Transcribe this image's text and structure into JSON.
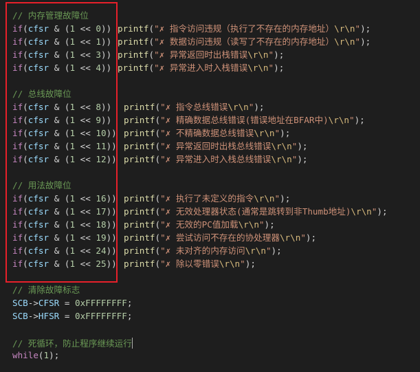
{
  "editor": {
    "accent": "#e8202a",
    "lines": [
      {
        "type": "comment",
        "text": "// 内存管理故障位"
      },
      {
        "type": "if",
        "reg": "cfsr",
        "bit": "0",
        "msg": "✗ 指令访问违规（执行了不存在的内存地址）",
        "esc": "\\r\\n"
      },
      {
        "type": "if",
        "reg": "cfsr",
        "bit": "1",
        "msg": "✗ 数据访问违规（读写了不存在的内存地址）",
        "esc": "\\r\\n"
      },
      {
        "type": "if",
        "reg": "cfsr",
        "bit": "3",
        "msg": "✗ 异常返回时出栈错误",
        "esc": "\\r\\n"
      },
      {
        "type": "if",
        "reg": "cfsr",
        "bit": "4",
        "msg": "✗ 异常进入时入栈错误",
        "esc": "\\r\\n"
      },
      {
        "type": "blank"
      },
      {
        "type": "comment",
        "text": "// 总线故障位"
      },
      {
        "type": "if",
        "reg": "cfsr",
        "bit": "8",
        "msg": "✗ 指令总线错误",
        "esc": "\\r\\n"
      },
      {
        "type": "if",
        "reg": "cfsr",
        "bit": "9",
        "msg": "✗ 精确数据总线错误(错误地址在BFAR中)",
        "esc": "\\r\\n"
      },
      {
        "type": "if",
        "reg": "cfsr",
        "bit": "10",
        "msg": "✗ 不精确数据总线错误",
        "esc": "\\r\\n"
      },
      {
        "type": "if",
        "reg": "cfsr",
        "bit": "11",
        "msg": "✗ 异常返回时出栈总线错误",
        "esc": "\\r\\n"
      },
      {
        "type": "if",
        "reg": "cfsr",
        "bit": "12",
        "msg": "✗ 异常进入时入栈总线错误",
        "esc": "\\r\\n"
      },
      {
        "type": "blank"
      },
      {
        "type": "comment",
        "text": "// 用法故障位"
      },
      {
        "type": "if",
        "reg": "cfsr",
        "bit": "16",
        "msg": "✗ 执行了未定义的指令",
        "esc": "\\r\\n"
      },
      {
        "type": "if",
        "reg": "cfsr",
        "bit": "17",
        "msg": "✗ 无效处理器状态(通常是跳转到非Thumb地址)",
        "esc": "\\r\\n"
      },
      {
        "type": "if",
        "reg": "cfsr",
        "bit": "18",
        "msg": "✗ 无效的PC值加载",
        "esc": "\\r\\n"
      },
      {
        "type": "if",
        "reg": "cfsr",
        "bit": "19",
        "msg": "✗ 尝试访问不存在的协处理器",
        "esc": "\\r\\n"
      },
      {
        "type": "if",
        "reg": "cfsr",
        "bit": "24",
        "msg": "✗ 未对齐的内存访问",
        "esc": "\\r\\n"
      },
      {
        "type": "if",
        "reg": "cfsr",
        "bit": "25",
        "msg": "✗ 除以零错误",
        "esc": "\\r\\n"
      },
      {
        "type": "blank"
      },
      {
        "type": "comment",
        "text": "// 清除故障标志"
      },
      {
        "type": "assign",
        "obj": "SCB",
        "field": "CFSR",
        "value": "0xFFFFFFFF"
      },
      {
        "type": "assign",
        "obj": "SCB",
        "field": "HFSR",
        "value": "0xFFFFFFFF"
      },
      {
        "type": "blank"
      },
      {
        "type": "comment",
        "text": "// 死循环，防止程序继续运行",
        "cursor": true
      },
      {
        "type": "while",
        "arg": "1"
      }
    ]
  }
}
